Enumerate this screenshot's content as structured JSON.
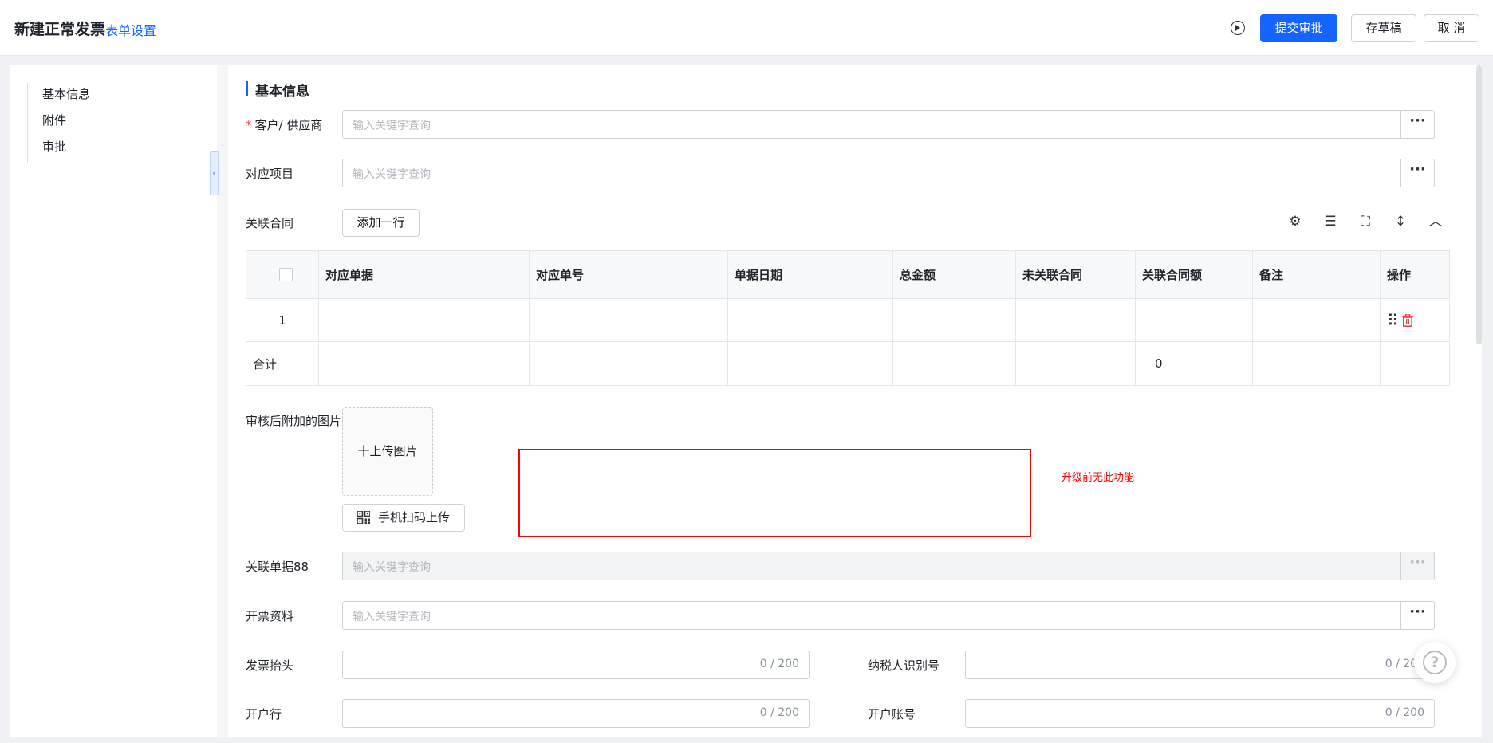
{
  "header": {
    "title": "新建正常发票",
    "settings_link": "表单设置",
    "submit_label": "提交审批",
    "draft_label": "存草稿",
    "cancel_label": "取 消"
  },
  "nav": {
    "items": [
      "基本信息",
      "附件",
      "审批"
    ]
  },
  "section": {
    "title": "基本信息"
  },
  "fields": {
    "customer_label": "客户/ 供应商",
    "customer_placeholder": "输入关键字查询",
    "project_label": "对应项目",
    "project_placeholder": "输入关键字查询",
    "contract_label": "关联合同",
    "add_row_label": "添加一行",
    "image_label": "审核后附加的图片",
    "upload_label": "十上传图片",
    "scan_label": "手机扫码上传",
    "related_doc_label": "关联单据88",
    "related_doc_placeholder": "输入关键字查询",
    "invoice_info_label": "开票资料",
    "invoice_info_placeholder": "输入关键字查询",
    "invoice_title_label": "发票抬头",
    "invoice_title_count": "0 / 200",
    "taxpayer_label": "纳税人识别号",
    "taxpayer_count": "0 / 200",
    "bank_label": "开户行",
    "bank_count": "0 / 200",
    "account_label": "开户账号",
    "account_count": "0 / 200"
  },
  "table": {
    "headers": [
      "对应单据",
      "对应单号",
      "单据日期",
      "总金额",
      "未关联合同",
      "关联合同额",
      "备注",
      "操作"
    ],
    "row_number": "1",
    "total_label": "合计",
    "total_contract_amount": "0"
  },
  "annotation": {
    "note": "升级前无此功能",
    "color": "#ff0000"
  },
  "icons": {
    "more": "more-icon",
    "settings": "gear-icon",
    "line_height": "line-height-icon",
    "fullscreen": "fullscreen-icon",
    "expand": "expand-vertical-icon",
    "collapse": "chevron-up-icon",
    "help": "help-icon"
  },
  "colors": {
    "primary": "#1664ff",
    "danger": "#f53f3f"
  }
}
